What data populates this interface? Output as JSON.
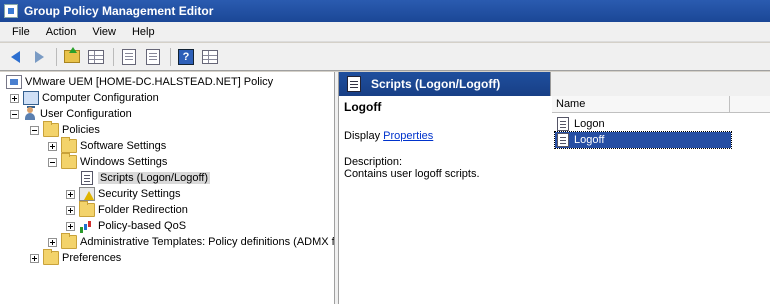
{
  "window": {
    "title": "Group Policy Management Editor"
  },
  "menubar": {
    "items": [
      "File",
      "Action",
      "View",
      "Help"
    ]
  },
  "tree": {
    "root": "VMware UEM [HOME-DC.HALSTEAD.NET] Policy",
    "computer_configuration": "Computer Configuration",
    "user_configuration": "User Configuration",
    "policies": "Policies",
    "software_settings": "Software Settings",
    "windows_settings": "Windows Settings",
    "scripts": "Scripts (Logon/Logoff)",
    "security_settings": "Security Settings",
    "folder_redirection": "Folder Redirection",
    "policy_based_qos": "Policy-based QoS",
    "admin_templates": "Administrative Templates: Policy definitions (ADMX f",
    "preferences": "Preferences"
  },
  "detail": {
    "header": "Scripts (Logon/Logoff)",
    "title": "Logoff",
    "display_label": "Display",
    "properties_link": "Properties",
    "description_label": "Description:",
    "description_text": "Contains user logoff scripts."
  },
  "list": {
    "column_name": "Name",
    "items": [
      "Logon",
      "Logoff"
    ]
  },
  "colors": {
    "titlebar": "#1b4796",
    "selection": "#264ea3",
    "link": "#0033cc"
  }
}
